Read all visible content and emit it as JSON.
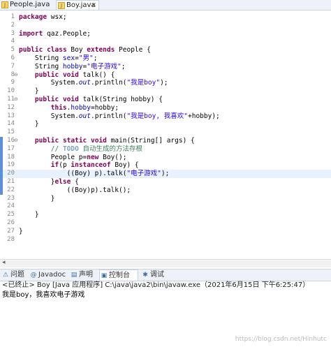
{
  "tabs": [
    {
      "label": "People.java",
      "active": false
    },
    {
      "label": "Boy.java",
      "active": true
    }
  ],
  "code_lines": [
    {
      "n": "1",
      "t": [
        {
          "k": "kw",
          "s": "package"
        },
        {
          "s": " wsx;"
        }
      ]
    },
    {
      "n": "2",
      "t": []
    },
    {
      "n": "3",
      "t": [
        {
          "k": "kw",
          "s": "import"
        },
        {
          "s": " qaz.People;"
        }
      ]
    },
    {
      "n": "4",
      "t": []
    },
    {
      "n": "5",
      "t": [
        {
          "k": "kw",
          "s": "public"
        },
        {
          "s": " "
        },
        {
          "k": "kw",
          "s": "class"
        },
        {
          "s": " Boy "
        },
        {
          "k": "kw",
          "s": "extends"
        },
        {
          "s": " People {"
        }
      ]
    },
    {
      "n": "6",
      "t": [
        {
          "s": "    String "
        },
        {
          "k": "fld",
          "s": "sex"
        },
        {
          "s": "="
        },
        {
          "k": "str",
          "s": "\"男\""
        },
        {
          "s": ";"
        }
      ]
    },
    {
      "n": "7",
      "t": [
        {
          "s": "    String "
        },
        {
          "k": "fld",
          "s": "hobby"
        },
        {
          "s": "="
        },
        {
          "k": "str",
          "s": "\"电子游戏\""
        },
        {
          "s": ";"
        }
      ]
    },
    {
      "n": "8",
      "mark": "⊖",
      "t": [
        {
          "s": "    "
        },
        {
          "k": "kw",
          "s": "public"
        },
        {
          "s": " "
        },
        {
          "k": "kw",
          "s": "void"
        },
        {
          "s": " talk() {"
        }
      ]
    },
    {
      "n": "9",
      "t": [
        {
          "s": "        System."
        },
        {
          "k": "fldit",
          "s": "out"
        },
        {
          "s": ".println("
        },
        {
          "k": "str",
          "s": "\"我是boy\""
        },
        {
          "s": ");"
        }
      ]
    },
    {
      "n": "10",
      "t": [
        {
          "s": "    }"
        }
      ]
    },
    {
      "n": "11",
      "mark": "⊖",
      "t": [
        {
          "s": "    "
        },
        {
          "k": "kw",
          "s": "public"
        },
        {
          "s": " "
        },
        {
          "k": "kw",
          "s": "void"
        },
        {
          "s": " talk(String hobby) {"
        }
      ]
    },
    {
      "n": "12",
      "t": [
        {
          "s": "        "
        },
        {
          "k": "kw",
          "s": "this"
        },
        {
          "s": "."
        },
        {
          "k": "fld",
          "s": "hobby"
        },
        {
          "s": "=hobby;"
        }
      ]
    },
    {
      "n": "13",
      "t": [
        {
          "s": "        System."
        },
        {
          "k": "fldit",
          "s": "out"
        },
        {
          "s": ".println("
        },
        {
          "k": "str",
          "s": "\"我是boy, 我喜欢\""
        },
        {
          "s": "+hobby);"
        }
      ]
    },
    {
      "n": "14",
      "t": [
        {
          "s": "    }"
        }
      ]
    },
    {
      "n": "15",
      "t": []
    },
    {
      "n": "16",
      "mark": "⊖",
      "t": [
        {
          "s": "    "
        },
        {
          "k": "kw",
          "s": "public"
        },
        {
          "s": " "
        },
        {
          "k": "kw",
          "s": "static"
        },
        {
          "s": " "
        },
        {
          "k": "kw",
          "s": "void"
        },
        {
          "s": " main(String[] args) {"
        }
      ]
    },
    {
      "n": "17",
      "t": [
        {
          "s": "        "
        },
        {
          "k": "cmt",
          "s": "// "
        },
        {
          "k": "todo",
          "s": "TODO"
        },
        {
          "k": "cmt",
          "s": " 自动生成的方法存根"
        }
      ]
    },
    {
      "n": "18",
      "t": [
        {
          "s": "        People p="
        },
        {
          "k": "kw",
          "s": "new"
        },
        {
          "s": " Boy();"
        }
      ]
    },
    {
      "n": "19",
      "t": [
        {
          "s": "        "
        },
        {
          "k": "kw",
          "s": "if"
        },
        {
          "s": "(p "
        },
        {
          "k": "kw",
          "s": "instanceof"
        },
        {
          "s": " Boy) {"
        }
      ]
    },
    {
      "n": "20",
      "hl": true,
      "t": [
        {
          "s": "            ((Boy) p).talk("
        },
        {
          "k": "str",
          "s": "\"电子游戏\""
        },
        {
          "s": ");"
        }
      ]
    },
    {
      "n": "21",
      "t": [
        {
          "s": "        }"
        },
        {
          "k": "kw",
          "s": "else"
        },
        {
          "s": " {"
        }
      ]
    },
    {
      "n": "22",
      "t": [
        {
          "s": "            ((Boy)p).talk();"
        }
      ]
    },
    {
      "n": "23",
      "t": [
        {
          "s": "        }"
        }
      ]
    },
    {
      "n": "24",
      "t": []
    },
    {
      "n": "25",
      "t": [
        {
          "s": "    }"
        }
      ]
    },
    {
      "n": "26",
      "t": []
    },
    {
      "n": "27",
      "t": [
        {
          "s": "}"
        }
      ]
    },
    {
      "n": "28",
      "t": []
    }
  ],
  "panel_tabs": [
    {
      "label": "问题",
      "icon": "⚠",
      "active": false
    },
    {
      "label": "Javadoc",
      "icon": "@",
      "active": false
    },
    {
      "label": "声明",
      "icon": "▤",
      "active": false
    },
    {
      "label": "控制台",
      "icon": "▣",
      "active": true
    },
    {
      "label": "调试",
      "icon": "✱",
      "active": false
    }
  ],
  "console": {
    "header": "<已终止> Boy [Java 应用程序] C:\\java\\java2\\bin\\javaw.exe（2021年6月15日 下午6:25:47）",
    "output": "我是boy，我喜欢电子游戏"
  },
  "watermark": "https://blog.csdn.net/Hinhutc"
}
